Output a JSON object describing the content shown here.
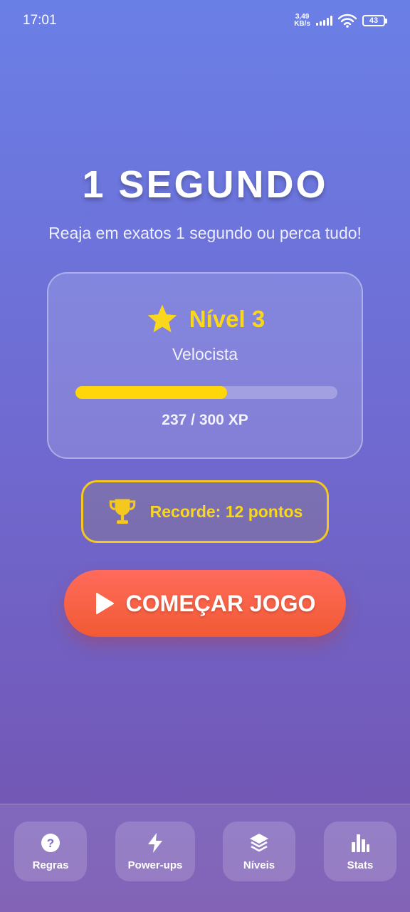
{
  "status_bar": {
    "time": "17:01",
    "net_speed_value": "3,49",
    "net_speed_unit": "KB/s",
    "battery": "43"
  },
  "header": {
    "title": "1 SEGUNDO",
    "subtitle": "Reaja em exatos 1 segundo ou perca tudo!"
  },
  "level_card": {
    "level_label": "Nível 3",
    "rank": "Velocista",
    "xp_text": "237 / 300 XP",
    "xp_progress": 0.58
  },
  "record": {
    "label": "Recorde: 12 pontos"
  },
  "start_button": {
    "label": "COMEÇAR JOGO"
  },
  "bottom_nav": {
    "items": [
      {
        "label": "Regras",
        "icon": "question-icon"
      },
      {
        "label": "Power-ups",
        "icon": "lightning-icon"
      },
      {
        "label": "Níveis",
        "icon": "layers-icon"
      },
      {
        "label": "Stats",
        "icon": "bar-chart-icon"
      }
    ]
  },
  "colors": {
    "accent_yellow": "#F9D71C",
    "start_button": "#F15A33"
  }
}
